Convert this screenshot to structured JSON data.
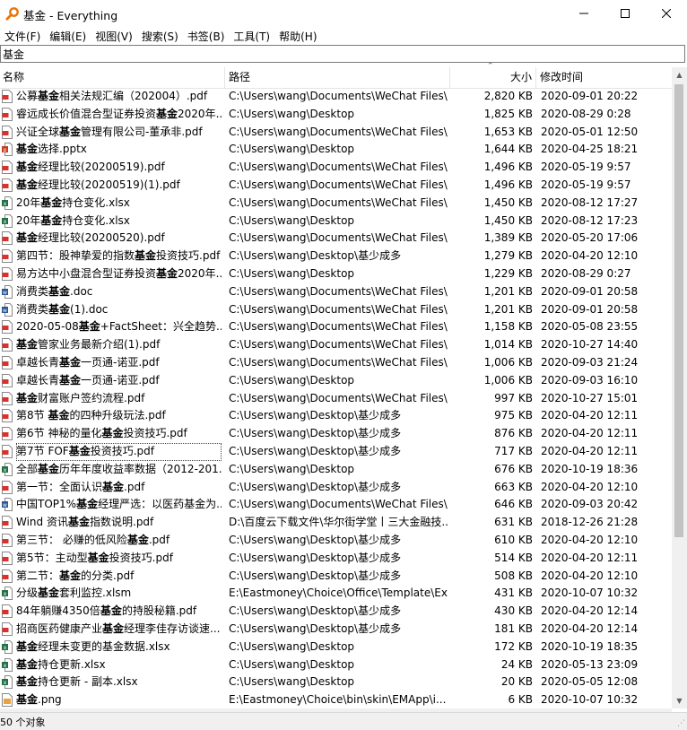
{
  "window": {
    "title": "基金 - Everything",
    "minimize_glyph": "─",
    "maximize_glyph": "☐",
    "close_glyph": "✕"
  },
  "icons": {
    "app": "magnifier-icon",
    "pdf": "pdf-file-icon",
    "excel": "excel-file-icon",
    "word": "word-file-icon",
    "ppt": "ppt-file-icon",
    "image": "image-file-icon"
  },
  "colors": {
    "pdf": "#d9322e",
    "excel": "#207245",
    "word": "#2b5797",
    "ppt": "#c43e1c",
    "image": "#e8a33d",
    "app": "#e8760b"
  },
  "menu": [
    "文件(F)",
    "编辑(E)",
    "视图(V)",
    "搜索(S)",
    "书签(B)",
    "工具(T)",
    "帮助(H)"
  ],
  "search": {
    "value": "基金"
  },
  "columns": {
    "name": "名称",
    "path": "路径",
    "size": "大小",
    "date": "修改时间",
    "sort_glyph": "⌃"
  },
  "scroll": {
    "up": "▲",
    "down": "▼"
  },
  "rows": [
    {
      "type": "pdf",
      "pre": "公募",
      "hl": "基金",
      "post": "相关法规汇编（202004）.pdf",
      "path": "C:\\Users\\wang\\Documents\\WeChat Files\\...",
      "size": "2,820 KB",
      "date": "2020-09-01 20:22"
    },
    {
      "type": "pdf",
      "pre": "睿远成长价值混合型证券投资",
      "hl": "基金",
      "post": "2020年...",
      "path": "C:\\Users\\wang\\Desktop",
      "size": "1,825 KB",
      "date": "2020-08-29 0:28"
    },
    {
      "type": "pdf",
      "pre": "兴证全球",
      "hl": "基金",
      "post": "管理有限公司-董承非.pdf",
      "path": "C:\\Users\\wang\\Documents\\WeChat Files\\...",
      "size": "1,653 KB",
      "date": "2020-05-01 12:50"
    },
    {
      "type": "ppt",
      "pre": "",
      "hl": "基金",
      "post": "选择.pptx",
      "path": "C:\\Users\\wang\\Desktop",
      "size": "1,644 KB",
      "date": "2020-04-25 18:21"
    },
    {
      "type": "pdf",
      "pre": "",
      "hl": "基金",
      "post": "经理比较(20200519).pdf",
      "path": "C:\\Users\\wang\\Documents\\WeChat Files\\...",
      "size": "1,496 KB",
      "date": "2020-05-19 9:57"
    },
    {
      "type": "pdf",
      "pre": "",
      "hl": "基金",
      "post": "经理比较(20200519)(1).pdf",
      "path": "C:\\Users\\wang\\Documents\\WeChat Files\\...",
      "size": "1,496 KB",
      "date": "2020-05-19 9:57"
    },
    {
      "type": "excel",
      "pre": "20年",
      "hl": "基金",
      "post": "持仓变化.xlsx",
      "path": "C:\\Users\\wang\\Documents\\WeChat Files\\...",
      "size": "1,450 KB",
      "date": "2020-08-12 17:27"
    },
    {
      "type": "excel",
      "pre": "20年",
      "hl": "基金",
      "post": "持仓变化.xlsx",
      "path": "C:\\Users\\wang\\Desktop",
      "size": "1,450 KB",
      "date": "2020-08-12 17:23"
    },
    {
      "type": "pdf",
      "pre": "",
      "hl": "基金",
      "post": "经理比较(20200520).pdf",
      "path": "C:\\Users\\wang\\Documents\\WeChat Files\\...",
      "size": "1,389 KB",
      "date": "2020-05-20 17:06"
    },
    {
      "type": "pdf",
      "pre": "第四节：股神挚爱的指数",
      "hl": "基金",
      "post": "投资技巧.pdf",
      "path": "C:\\Users\\wang\\Desktop\\基少成多",
      "size": "1,279 KB",
      "date": "2020-04-20 12:10"
    },
    {
      "type": "pdf",
      "pre": "易方达中小盘混合型证券投资",
      "hl": "基金",
      "post": "2020年...",
      "path": "C:\\Users\\wang\\Desktop",
      "size": "1,229 KB",
      "date": "2020-08-29 0:27"
    },
    {
      "type": "word",
      "pre": "消费类",
      "hl": "基金",
      "post": ".doc",
      "path": "C:\\Users\\wang\\Documents\\WeChat Files\\...",
      "size": "1,201 KB",
      "date": "2020-09-01 20:58"
    },
    {
      "type": "word",
      "pre": "消费类",
      "hl": "基金",
      "post": "(1).doc",
      "path": "C:\\Users\\wang\\Documents\\WeChat Files\\...",
      "size": "1,201 KB",
      "date": "2020-09-01 20:58"
    },
    {
      "type": "pdf",
      "pre": "2020-05-08",
      "hl": "基金",
      "post": "+FactSheet：兴全趋势...",
      "path": "C:\\Users\\wang\\Documents\\WeChat Files\\...",
      "size": "1,158 KB",
      "date": "2020-05-08 23:55"
    },
    {
      "type": "pdf",
      "pre": "",
      "hl": "基金",
      "post": "管家业务最新介绍(1).pdf",
      "path": "C:\\Users\\wang\\Documents\\WeChat Files\\...",
      "size": "1,014 KB",
      "date": "2020-10-27 14:40"
    },
    {
      "type": "pdf",
      "pre": "卓越长青",
      "hl": "基金",
      "post": "一页通-诺亚.pdf",
      "path": "C:\\Users\\wang\\Documents\\WeChat Files\\...",
      "size": "1,006 KB",
      "date": "2020-09-03 21:24"
    },
    {
      "type": "pdf",
      "pre": "卓越长青",
      "hl": "基金",
      "post": "一页通-诺亚.pdf",
      "path": "C:\\Users\\wang\\Desktop",
      "size": "1,006 KB",
      "date": "2020-09-03 16:10"
    },
    {
      "type": "pdf",
      "pre": "",
      "hl": "基金",
      "post": "财富账户签约流程.pdf",
      "path": "C:\\Users\\wang\\Documents\\WeChat Files\\...",
      "size": "997 KB",
      "date": "2020-10-27 15:01"
    },
    {
      "type": "pdf",
      "pre": "第8节 ",
      "hl": "基金",
      "post": "的四种升级玩法.pdf",
      "path": "C:\\Users\\wang\\Desktop\\基少成多",
      "size": "975 KB",
      "date": "2020-04-20 12:11"
    },
    {
      "type": "pdf",
      "pre": "第6节 神秘的量化",
      "hl": "基金",
      "post": "投资技巧.pdf",
      "path": "C:\\Users\\wang\\Desktop\\基少成多",
      "size": "876 KB",
      "date": "2020-04-20 12:11"
    },
    {
      "type": "pdf",
      "pre": "第7节 FOF",
      "hl": "基金",
      "post": "投资技巧.pdf",
      "path": "C:\\Users\\wang\\Desktop\\基少成多",
      "size": "717 KB",
      "date": "2020-04-20 12:11",
      "focus": true
    },
    {
      "type": "excel",
      "pre": "全部",
      "hl": "基金",
      "post": "历年年度收益率数据（2012-201...",
      "path": "C:\\Users\\wang\\Desktop",
      "size": "676 KB",
      "date": "2020-10-19 18:36"
    },
    {
      "type": "pdf",
      "pre": "第一节：全面认识",
      "hl": "基金",
      "post": ".pdf",
      "path": "C:\\Users\\wang\\Desktop\\基少成多",
      "size": "663 KB",
      "date": "2020-04-20 12:10"
    },
    {
      "type": "word",
      "pre": "中国TOP1%",
      "hl": "基金",
      "post": "经理严选：以医药基金为...",
      "path": "C:\\Users\\wang\\Documents\\WeChat Files\\...",
      "size": "646 KB",
      "date": "2020-09-03 20:42"
    },
    {
      "type": "pdf",
      "pre": "Wind 资讯",
      "hl": "基金",
      "post": "指数说明.pdf",
      "path": "D:\\百度云下载文件\\华尔街学堂丨三大金融技...",
      "size": "631 KB",
      "date": "2018-12-26 21:28"
    },
    {
      "type": "pdf",
      "pre": "第三节：  必赚的低风险",
      "hl": "基金",
      "post": ".pdf",
      "path": "C:\\Users\\wang\\Desktop\\基少成多",
      "size": "610 KB",
      "date": "2020-04-20 12:10"
    },
    {
      "type": "pdf",
      "pre": "第5节：主动型",
      "hl": "基金",
      "post": "投资技巧.pdf",
      "path": "C:\\Users\\wang\\Desktop\\基少成多",
      "size": "514 KB",
      "date": "2020-04-20 12:11"
    },
    {
      "type": "pdf",
      "pre": "第二节：",
      "hl": "基金",
      "post": "的分类.pdf",
      "path": "C:\\Users\\wang\\Desktop\\基少成多",
      "size": "508 KB",
      "date": "2020-04-20 12:10"
    },
    {
      "type": "excel",
      "pre": "分级",
      "hl": "基金",
      "post": "套利监控.xlsm",
      "path": "E:\\Eastmoney\\Choice\\Office\\Template\\Ex...",
      "size": "431 KB",
      "date": "2020-10-07 10:32"
    },
    {
      "type": "pdf",
      "pre": "84年躺赚4350倍",
      "hl": "基金",
      "post": "的持股秘籍.pdf",
      "path": "C:\\Users\\wang\\Desktop\\基少成多",
      "size": "430 KB",
      "date": "2020-04-20 12:14"
    },
    {
      "type": "pdf",
      "pre": "招商医药健康产业",
      "hl": "基金",
      "post": "经理李佳存访谈速...",
      "path": "C:\\Users\\wang\\Desktop\\基少成多",
      "size": "181 KB",
      "date": "2020-04-20 12:14"
    },
    {
      "type": "excel",
      "pre": "",
      "hl": "基金",
      "post": "经理未变更的基金数据.xlsx",
      "path": "C:\\Users\\wang\\Desktop",
      "size": "172 KB",
      "date": "2020-10-19 18:35"
    },
    {
      "type": "excel",
      "pre": "",
      "hl": "基金",
      "post": "持仓更新.xlsx",
      "path": "C:\\Users\\wang\\Desktop",
      "size": "24 KB",
      "date": "2020-05-13 23:09"
    },
    {
      "type": "excel",
      "pre": "",
      "hl": "基金",
      "post": "持仓更新 - 副本.xlsx",
      "path": "C:\\Users\\wang\\Desktop",
      "size": "20 KB",
      "date": "2020-05-05 12:08"
    },
    {
      "type": "image",
      "pre": "",
      "hl": "基金",
      "post": ".png",
      "path": "E:\\Eastmoney\\Choice\\bin\\skin\\EMApp\\i...",
      "size": "6 KB",
      "date": "2020-10-07 10:32"
    }
  ],
  "status": {
    "text": "50 个对象",
    "grip_glyph": "⋰"
  }
}
